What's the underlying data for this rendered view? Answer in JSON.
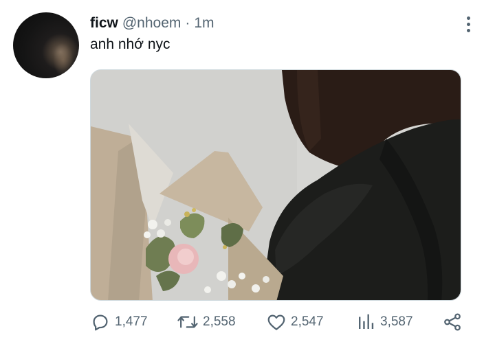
{
  "tweet": {
    "display_name": "ficw",
    "handle": "@nhoem",
    "separator": "·",
    "time": "1m",
    "text": "anh nhớ nyc"
  },
  "actions": {
    "reply_count": "1,477",
    "retweet_count": "2,558",
    "like_count": "2,547",
    "views_count": "3,587"
  },
  "icons": {
    "reply": "speech-bubble-icon",
    "retweet": "retweet-arrows-icon",
    "like": "heart-icon",
    "views": "bar-chart-icon",
    "share": "share-nodes-icon",
    "more": "vertical-ellipsis-icon"
  },
  "colors": {
    "text_primary": "#0f1419",
    "text_secondary": "#536471"
  }
}
